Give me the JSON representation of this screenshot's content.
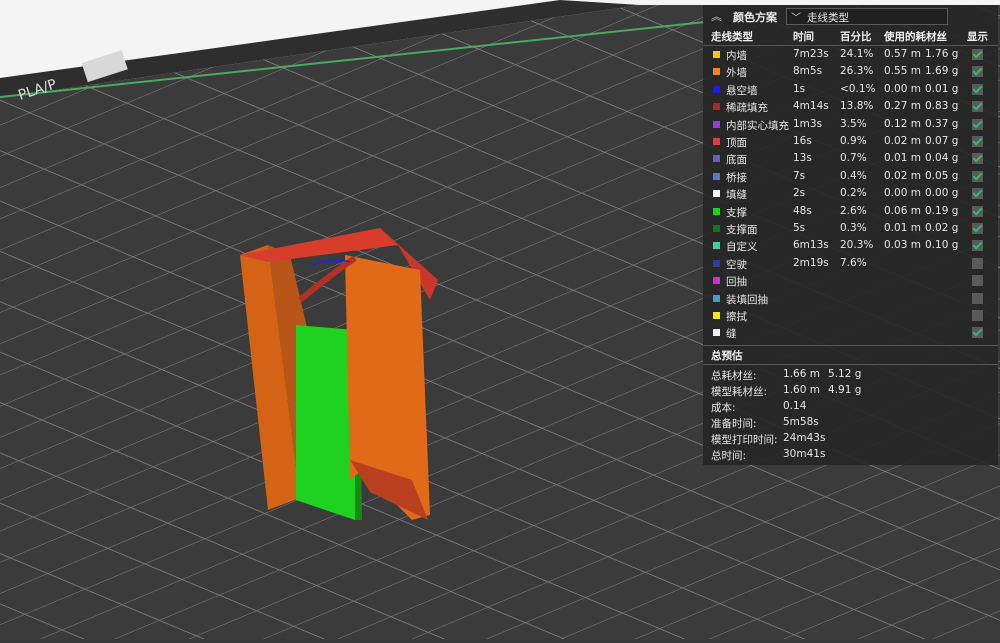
{
  "viewport": {
    "plate_label": "PLA/P",
    "plate_color": "#3d3d3d",
    "model_colors": {
      "outer_wall": "#e06a18",
      "inner_wall": "#c23c2c",
      "support": "#19d619"
    }
  },
  "panel": {
    "collapse_icon": "double-chevron-up-icon",
    "title": "颜色方案",
    "scheme_select": {
      "value": "走线类型",
      "icon": "chevron-down-icon"
    },
    "columns": {
      "type": "走线类型",
      "time": "时间",
      "percent": "百分比",
      "usage": "使用的耗材丝",
      "show": "显示"
    },
    "rows": [
      {
        "color": "#ffc21a",
        "name": "内墙",
        "time": "7m23s",
        "percent": "24.1%",
        "length": "0.57 m",
        "weight": "1.76 g",
        "shown": true
      },
      {
        "color": "#f5812a",
        "name": "外墙",
        "time": "8m5s",
        "percent": "26.3%",
        "length": "0.55 m",
        "weight": "1.69 g",
        "shown": true
      },
      {
        "color": "#1a1ae6",
        "name": "悬空墙",
        "time": "1s",
        "percent": "<0.1%",
        "length": "0.00 m",
        "weight": "0.01 g",
        "shown": true
      },
      {
        "color": "#b02626",
        "name": "稀疏填充",
        "time": "4m14s",
        "percent": "13.8%",
        "length": "0.27 m",
        "weight": "0.83 g",
        "shown": true
      },
      {
        "color": "#9b3ad6",
        "name": "内部实心填充",
        "time": "1m3s",
        "percent": "3.5%",
        "length": "0.12 m",
        "weight": "0.37 g",
        "shown": true
      },
      {
        "color": "#e33b3b",
        "name": "顶面",
        "time": "16s",
        "percent": "0.9%",
        "length": "0.02 m",
        "weight": "0.07 g",
        "shown": true
      },
      {
        "color": "#6a5acd",
        "name": "底面",
        "time": "13s",
        "percent": "0.7%",
        "length": "0.01 m",
        "weight": "0.04 g",
        "shown": true
      },
      {
        "color": "#4e7ac7",
        "name": "桥接",
        "time": "7s",
        "percent": "0.4%",
        "length": "0.02 m",
        "weight": "0.05 g",
        "shown": true
      },
      {
        "color": "#ffffff",
        "name": "填缝",
        "time": "2s",
        "percent": "0.2%",
        "length": "0.00 m",
        "weight": "0.00 g",
        "shown": true
      },
      {
        "color": "#19d619",
        "name": "支撑",
        "time": "48s",
        "percent": "2.6%",
        "length": "0.06 m",
        "weight": "0.19 g",
        "shown": true
      },
      {
        "color": "#127a12",
        "name": "支撑面",
        "time": "5s",
        "percent": "0.3%",
        "length": "0.01 m",
        "weight": "0.02 g",
        "shown": true
      },
      {
        "color": "#3ccf9a",
        "name": "自定义",
        "time": "6m13s",
        "percent": "20.3%",
        "length": "0.03 m",
        "weight": "0.10 g",
        "shown": true
      },
      {
        "color": "#2a3f99",
        "name": "空驶",
        "time": "2m19s",
        "percent": "7.6%",
        "length": "",
        "weight": "",
        "shown": false
      },
      {
        "color": "#d62ad6",
        "name": "回抽",
        "time": "",
        "percent": "",
        "length": "",
        "weight": "",
        "shown": false
      },
      {
        "color": "#3aa0c8",
        "name": "装填回抽",
        "time": "",
        "percent": "",
        "length": "",
        "weight": "",
        "shown": false
      },
      {
        "color": "#f5e61a",
        "name": "擦拭",
        "time": "",
        "percent": "",
        "length": "",
        "weight": "",
        "shown": false
      },
      {
        "color": "#f2f2f2",
        "name": "缝",
        "time": "",
        "percent": "",
        "length": "",
        "weight": "",
        "shown": true
      }
    ],
    "summary": {
      "title": "总预估",
      "items": [
        {
          "label": "总耗材丝:",
          "v1": "1.66 m",
          "v2": "5.12 g"
        },
        {
          "label": "模型耗材丝:",
          "v1": "1.60 m",
          "v2": "4.91 g"
        },
        {
          "label": "成本:",
          "v1": "0.14",
          "v2": ""
        },
        {
          "label": "准备时间:",
          "v1": "5m58s",
          "v2": ""
        },
        {
          "label": "模型打印时间:",
          "v1": "24m43s",
          "v2": ""
        },
        {
          "label": "总时间:",
          "v1": "30m41s",
          "v2": ""
        }
      ]
    }
  }
}
